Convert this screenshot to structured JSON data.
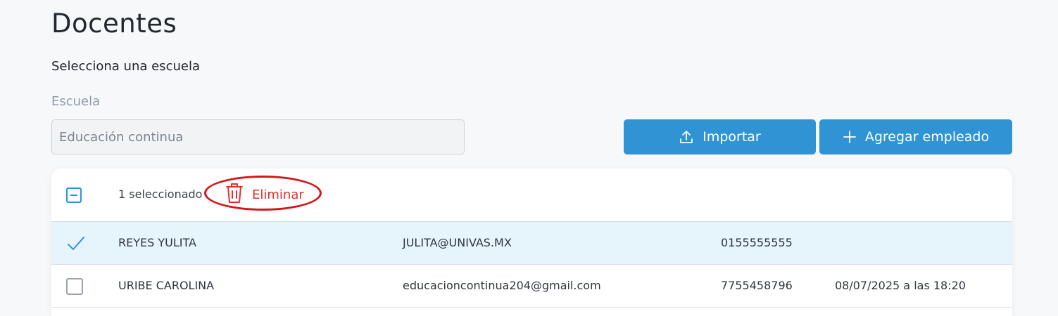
{
  "page": {
    "title": "Docentes",
    "subtitle": "Selecciona una escuela"
  },
  "school": {
    "label": "Escuela",
    "value": "Educación continua"
  },
  "actions": {
    "import_label": "Importar",
    "add_label": "Agregar empleado"
  },
  "table": {
    "selected_text": "1 seleccionado",
    "delete_label": "Eliminar",
    "rows": [
      {
        "name": "REYES YULITA",
        "email": "JULITA@UNIVAS.MX",
        "phone": "0155555555",
        "date": "",
        "selected": true
      },
      {
        "name": "URIBE CAROLINA",
        "email": "educacioncontinua204@gmail.com",
        "phone": "7755458796",
        "date": "08/07/2025 a las 18:20",
        "selected": false
      }
    ]
  },
  "colors": {
    "primary": "#2f93d4",
    "danger": "#e0302a",
    "selected_row": "#e6f4fc",
    "annotation": "#d8141a"
  },
  "icons": {
    "import": "upload-icon",
    "add": "plus-icon",
    "delete": "trash-icon",
    "selected": "check-icon"
  }
}
